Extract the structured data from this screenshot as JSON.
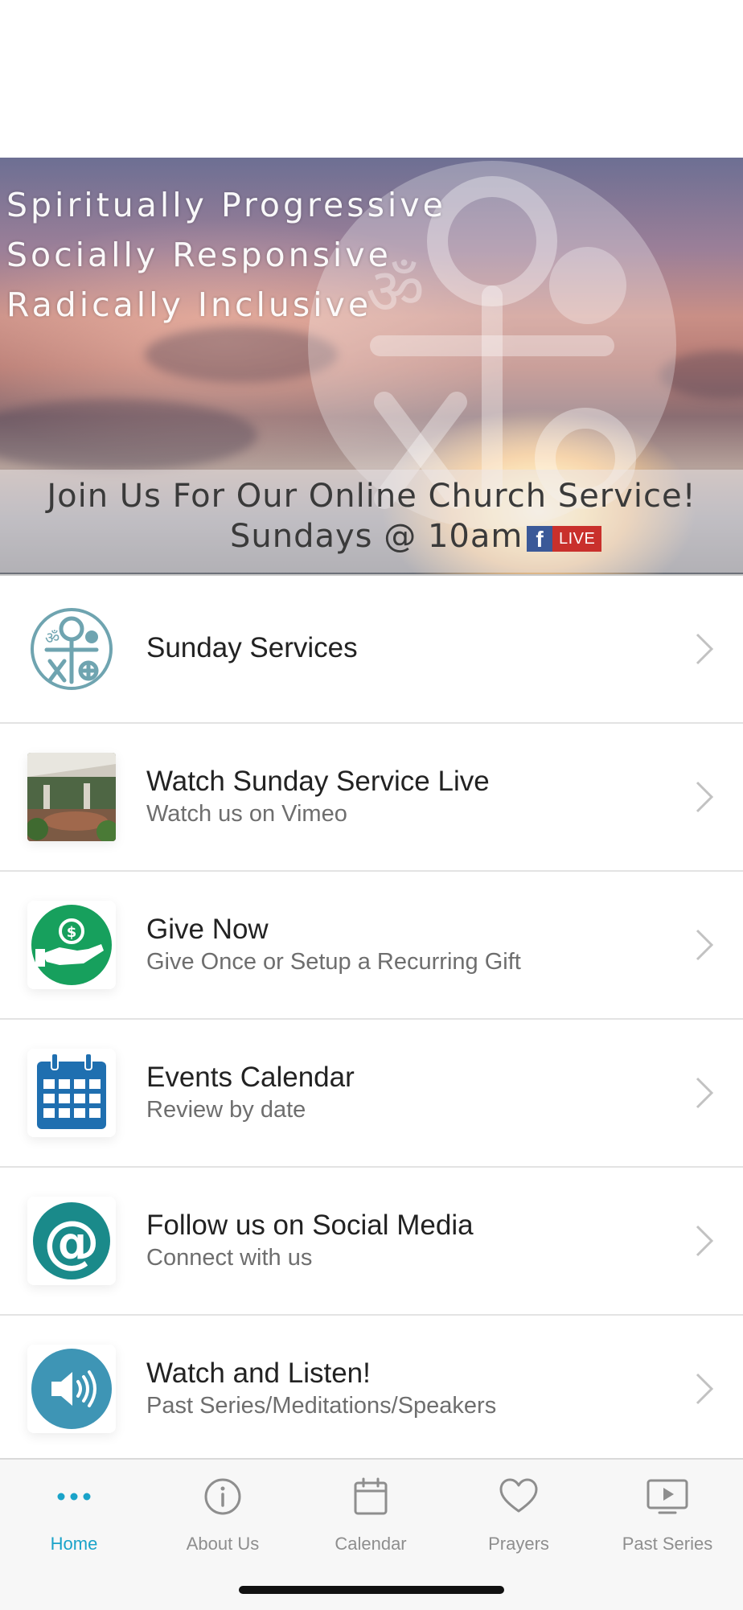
{
  "hero": {
    "motto": [
      "Spiritually Progressive",
      "Socially Responsive",
      "Radically Inclusive"
    ],
    "service_line1": "Join Us For Our Online Church Service!",
    "service_line2": "Sundays @ 10am",
    "fb_glyph": "f",
    "live_badge": "LIVE"
  },
  "menu": [
    {
      "title": "Sunday Services",
      "subtitle": "",
      "icon": "interfaith-symbol-icon"
    },
    {
      "title": "Watch Sunday Service Live",
      "subtitle": "Watch us on Vimeo",
      "icon": "sanctuary-photo"
    },
    {
      "title": "Give Now",
      "subtitle": "Give Once or Setup a Recurring Gift",
      "icon": "giving-hand-icon"
    },
    {
      "title": "Events Calendar",
      "subtitle": "Review by date",
      "icon": "calendar-icon"
    },
    {
      "title": "Follow us on Social Media",
      "subtitle": "Connect with us",
      "icon": "at-sign-icon"
    },
    {
      "title": "Watch and Listen!",
      "subtitle": "Past Series/Meditations/Speakers",
      "icon": "speaker-icon"
    }
  ],
  "tabs": [
    {
      "label": "Home",
      "icon": "more-dots-icon",
      "active": true
    },
    {
      "label": "About Us",
      "icon": "info-icon",
      "active": false
    },
    {
      "label": "Calendar",
      "icon": "calendar-icon",
      "active": false
    },
    {
      "label": "Prayers",
      "icon": "heart-icon",
      "active": false
    },
    {
      "label": "Past Series",
      "icon": "play-screen-icon",
      "active": false
    }
  ],
  "colors": {
    "accent": "#1aa3c9",
    "give_green": "#17a05d",
    "calendar_blue": "#1f6fb0",
    "social_teal": "#1a8a8a",
    "audio_blue": "#3e95b5",
    "live_red": "#c9302c",
    "facebook_blue": "#3b5998"
  }
}
